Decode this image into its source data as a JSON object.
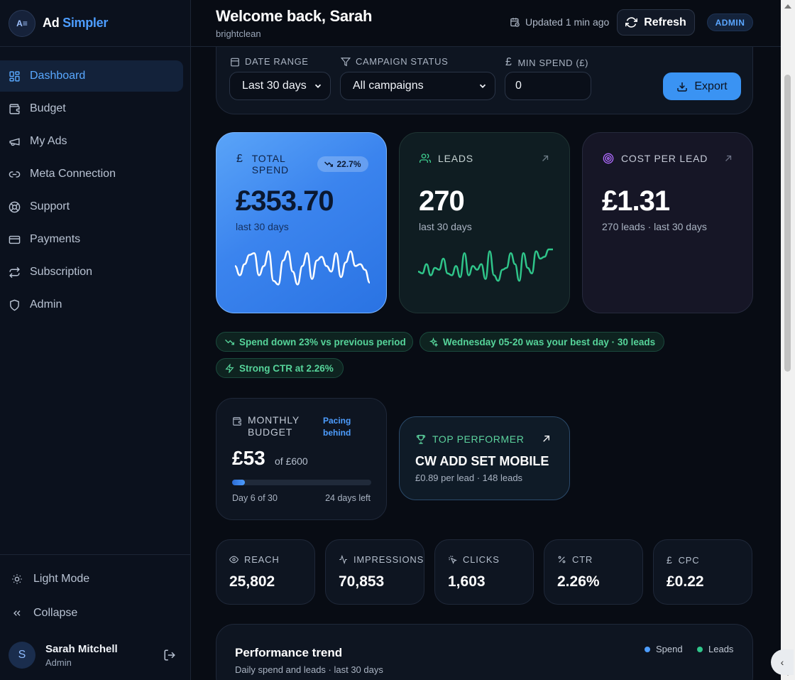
{
  "brand": {
    "logo_text": "A≡",
    "name_part1": "Ad",
    "name_part2": "Simpler"
  },
  "sidebar": {
    "items": [
      {
        "label": "Dashboard",
        "icon": "grid-icon",
        "active": true
      },
      {
        "label": "Budget",
        "icon": "wallet-icon",
        "active": false
      },
      {
        "label": "My Ads",
        "icon": "megaphone-icon",
        "active": false
      },
      {
        "label": "Meta Connection",
        "icon": "link-icon",
        "active": false
      },
      {
        "label": "Support",
        "icon": "lifebuoy-icon",
        "active": false
      },
      {
        "label": "Payments",
        "icon": "credit-card-icon",
        "active": false
      },
      {
        "label": "Subscription",
        "icon": "repeat-icon",
        "active": false
      },
      {
        "label": "Admin",
        "icon": "shield-icon",
        "active": false
      }
    ],
    "light_mode_label": "Light Mode",
    "collapse_label": "Collapse",
    "user": {
      "initial": "S",
      "name": "Sarah Mitchell",
      "role": "Admin"
    }
  },
  "header": {
    "welcome": "Welcome back, Sarah",
    "org": "brightclean",
    "updated": "Updated 1 min ago",
    "refresh_label": "Refresh",
    "role_badge": "ADMIN"
  },
  "filters": {
    "date_range_label": "DATE RANGE",
    "date_range_value": "Last 30 days",
    "campaign_status_label": "CAMPAIGN STATUS",
    "campaign_status_value": "All campaigns",
    "min_spend_label": "MIN SPEND (£)",
    "min_spend_value": "0",
    "export_label": "Export"
  },
  "kpis": {
    "spend": {
      "label": "TOTAL SPEND",
      "value": "£353.70",
      "sub": "last 30 days",
      "trend": "22.7%",
      "spark": [
        0.55,
        0.3,
        0.6,
        0.85,
        0.9,
        0.3,
        0.55,
        0.95,
        0.15,
        0.05,
        0.7,
        0.95,
        0.4,
        0.05,
        0.55,
        0.9,
        0.2,
        0.7,
        0.8,
        0.55,
        0.4,
        0.9,
        0.25,
        0.65,
        0.95,
        0.55,
        0.6,
        0.45,
        0.1
      ]
    },
    "leads": {
      "label": "LEADS",
      "value": "270",
      "sub": "last 30 days",
      "spark": [
        0.4,
        0.35,
        0.6,
        0.3,
        0.5,
        0.45,
        0.75,
        0.35,
        0.3,
        0.55,
        0.25,
        0.9,
        0.3,
        0.55,
        0.45,
        0.6,
        0.2,
        0.95,
        0.3,
        0.15,
        0.45,
        0.5,
        0.9,
        0.6,
        0.15,
        0.9,
        0.5,
        0.35,
        0.95,
        0.75,
        0.8,
        1.0,
        1.0
      ]
    },
    "cpl": {
      "label": "COST PER LEAD",
      "value": "£1.31",
      "sub": "270 leads · last 30 days"
    }
  },
  "insights": [
    {
      "text": "Spend down 23% vs previous period",
      "icon": "trend-down-icon"
    },
    {
      "text": "Wednesday 05-20 was your best day · 30 leads",
      "icon": "sparkles-icon"
    },
    {
      "text": "Strong CTR at 2.26%",
      "icon": "zap-icon"
    }
  ],
  "budget": {
    "label": "MONTHLY BUDGET",
    "pacing": "Pacing behind",
    "amount": "£53",
    "of": "of £600",
    "progress": 0.09,
    "day": "Day 6 of 30",
    "left": "24 days left"
  },
  "top_performer": {
    "label": "TOP PERFORMER",
    "name": "CW ADD SET MOBILE",
    "sub": "£0.89 per lead · 148 leads"
  },
  "metrics": [
    {
      "label": "REACH",
      "value": "25,802",
      "icon": "eye-icon"
    },
    {
      "label": "IMPRESSIONS",
      "value": "70,853",
      "icon": "activity-icon"
    },
    {
      "label": "CLICKS",
      "value": "1,603",
      "icon": "cursor-click-icon"
    },
    {
      "label": "CTR",
      "value": "2.26%",
      "icon": "percent-icon"
    },
    {
      "label": "CPC",
      "value": "£0.22",
      "icon": "pound-icon"
    }
  ],
  "performance": {
    "title": "Performance trend",
    "subtitle": "Daily spend and leads · last 30 days",
    "legend": [
      {
        "name": "Spend",
        "color": "#4d9dff"
      },
      {
        "name": "Leads",
        "color": "#2fc58a"
      }
    ]
  },
  "colors": {
    "accent": "#4d9dff",
    "success": "#56d49a",
    "background": "#080c14"
  }
}
